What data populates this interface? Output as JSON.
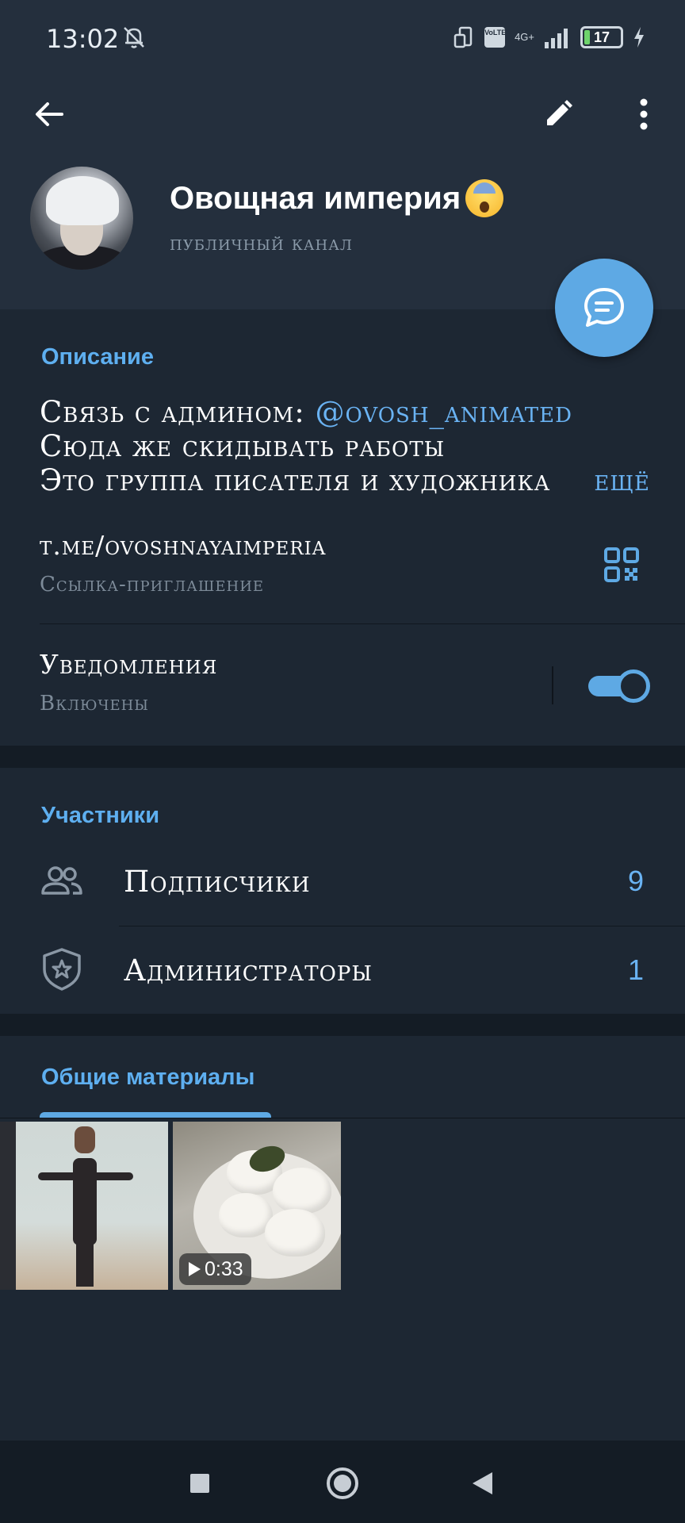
{
  "status_bar": {
    "time": "13:02",
    "battery_level": "17",
    "network": "4G+",
    "volte": "VoLTE"
  },
  "header": {
    "channel_name": "Овощная империя",
    "channel_type": "публичный канал"
  },
  "description": {
    "title": "Описание",
    "line1_prefix": "Связь с админом: ",
    "line1_mention": "@ovosh_animated",
    "line2": "Сюда же скидывать работы",
    "line3": "Это группа писателя и художника",
    "more": "ещё"
  },
  "invite_link": {
    "value": "t.me/ovoshnayaimperia",
    "label": "Ссылка-приглашение"
  },
  "notifications": {
    "label": "Уведомления",
    "state": "Включены",
    "enabled": true
  },
  "members": {
    "title": "Участники",
    "subscribers_label": "Подписчики",
    "subscribers_count": "9",
    "admins_label": "Администраторы",
    "admins_count": "1"
  },
  "shared": {
    "title": "Общие материалы",
    "video_duration": "0:33"
  },
  "colors": {
    "accent": "#5ea9e4",
    "background": "#1d2733",
    "header_bg": "#242f3d",
    "link": "#6ab3f3"
  }
}
